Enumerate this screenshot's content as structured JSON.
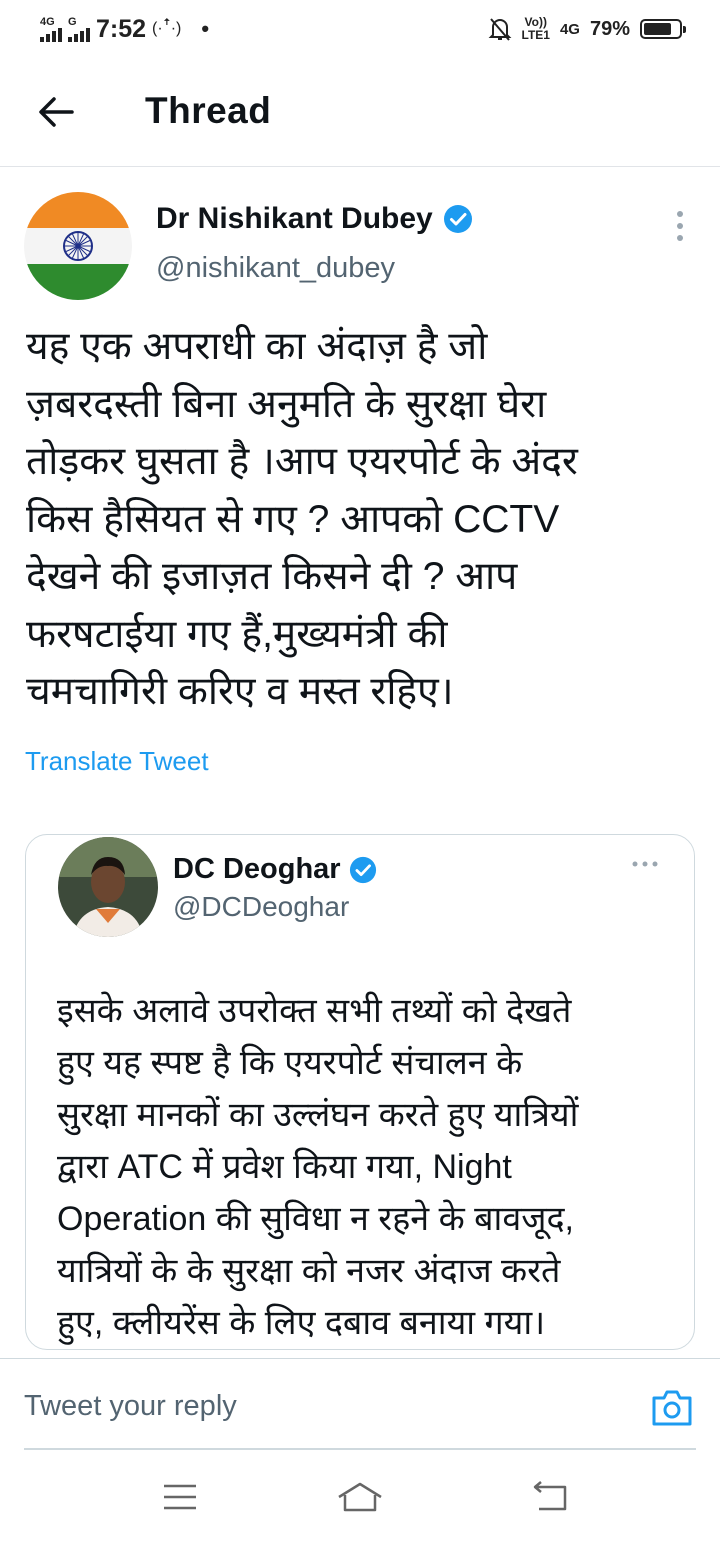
{
  "status_bar": {
    "network1": "4G",
    "network2": "G",
    "time": "7:52",
    "volte_top": "Vo))",
    "volte_bottom": "LTE1",
    "network3": "4G",
    "battery_percent": "79%",
    "battery_level": 0.79
  },
  "header": {
    "title": "Thread"
  },
  "tweet": {
    "author_name": "Dr Nishikant Dubey",
    "author_handle": "@nishikant_dubey",
    "lines": [
      "यह एक अपराधी का अंदाज़ है जो",
      "ज़बरदस्ती बिना अनुमति के सुरक्षा घेरा",
      "तोड़कर घुसता है ।आप एयरपोर्ट के अंदर",
      "किस हैसियत से गए ? आपको CCTV",
      "देखने की इजाज़त किसने दी ? आप",
      "फरषटाईया गए हैं,मुख्यमंत्री की",
      "चमचागिरी करिए व मस्त रहिए।"
    ],
    "translate_label": "Translate Tweet"
  },
  "quoted_tweet": {
    "author_name": "DC Deoghar",
    "author_handle": "@DCDeoghar",
    "lines": [
      "इसके अलावे उपरोक्त सभी तथ्यों को देखते",
      "हुए यह स्पष्ट है कि एयरपोर्ट संचालन के",
      "सुरक्षा मानकों का उल्लंघन करते हुए यात्रियों",
      "द्वारा ATC में प्रवेश किया गया, Night",
      "Operation की सुविधा न रहने के बावजूद,",
      "यात्रियों के के सुरक्षा को नजर अंदाज करते",
      "हुए, क्लीयरेंस के लिए दबाव बनाया गया।"
    ]
  },
  "reply": {
    "placeholder": "Tweet your reply"
  },
  "colors": {
    "accent": "#1d9bf0",
    "text": "#0f1419",
    "secondary": "#536471",
    "border": "#cfd9de"
  },
  "icons": [
    "back-arrow-icon",
    "verified-badge-icon",
    "more-vertical-icon",
    "more-horizontal-icon",
    "camera-icon",
    "menu-icon",
    "home-icon",
    "back-nav-icon"
  ]
}
